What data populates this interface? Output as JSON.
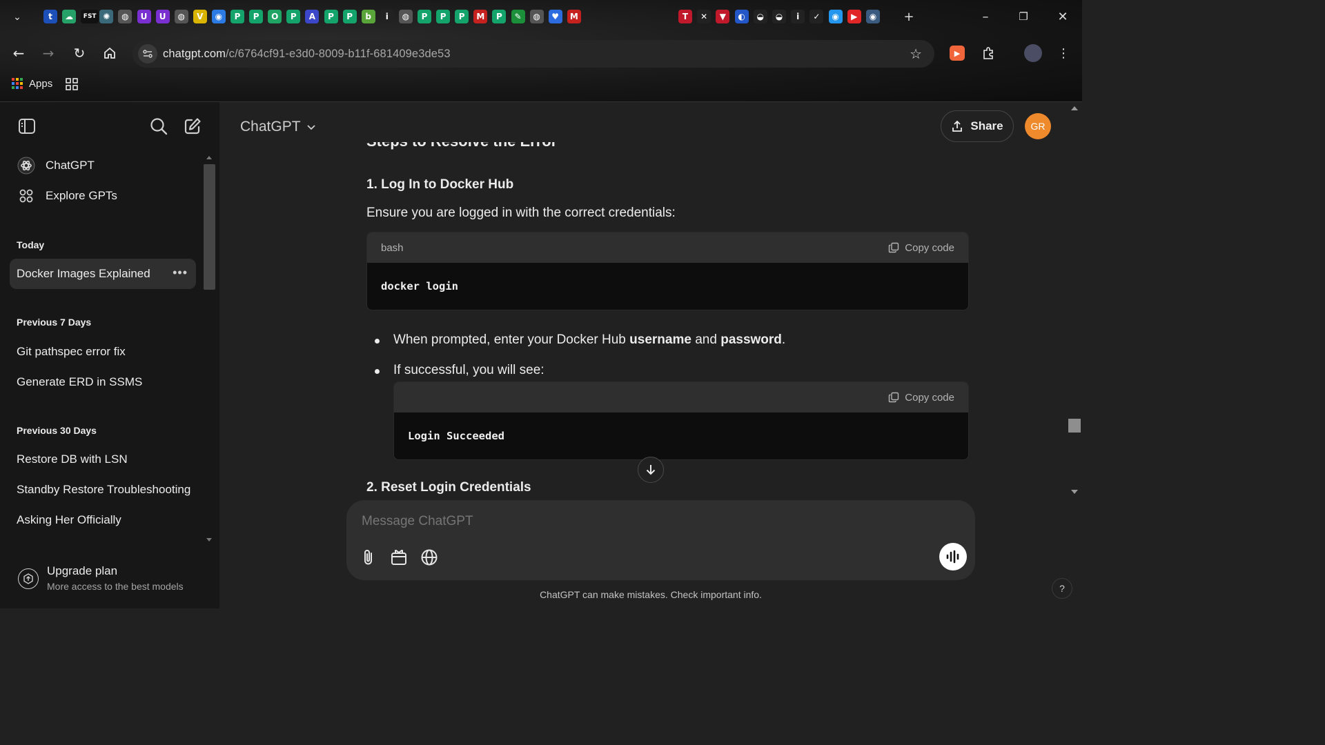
{
  "browser": {
    "url_host": "chatgpt.com",
    "url_path": "/c/6764cf91-e3d0-8009-b11f-681409e3de53",
    "bookmarks": {
      "apps_label": "Apps"
    },
    "tab_favicons": [
      {
        "name": "tumblr",
        "glyph": "t",
        "color": "#1d4fb8"
      },
      {
        "name": "cloud",
        "glyph": "☁",
        "color": "#26a269"
      },
      {
        "name": "fst",
        "glyph": "FST",
        "color": "#111111"
      },
      {
        "name": "openai",
        "glyph": "✺",
        "color": "#3a6a7a"
      },
      {
        "name": "globe",
        "glyph": "◍",
        "color": "#555555"
      },
      {
        "name": "u1",
        "glyph": "U",
        "color": "#7a2fd0"
      },
      {
        "name": "u2",
        "glyph": "U",
        "color": "#7a2fd0"
      },
      {
        "name": "globe2",
        "glyph": "◍",
        "color": "#555555"
      },
      {
        "name": "vue",
        "glyph": "V",
        "color": "#d9b400"
      },
      {
        "name": "chrome-color",
        "glyph": "◉",
        "color": "#2c7be5"
      },
      {
        "name": "p1",
        "glyph": "P",
        "color": "#14a36b"
      },
      {
        "name": "p2",
        "glyph": "P",
        "color": "#14a36b"
      },
      {
        "name": "ring",
        "glyph": "O",
        "color": "#1fa463"
      },
      {
        "name": "p3",
        "glyph": "P",
        "color": "#14a36b"
      },
      {
        "name": "a-font",
        "glyph": "A",
        "color": "#3b46c8"
      },
      {
        "name": "p4",
        "glyph": "P",
        "color": "#14a36b"
      },
      {
        "name": "p5",
        "glyph": "P",
        "color": "#14a36b"
      },
      {
        "name": "b-green",
        "glyph": "b",
        "color": "#5aa53a"
      },
      {
        "name": "info-i",
        "glyph": "i",
        "color": "#222222"
      },
      {
        "name": "globe3",
        "glyph": "◍",
        "color": "#555555"
      },
      {
        "name": "p6",
        "glyph": "P",
        "color": "#14a36b"
      },
      {
        "name": "p7",
        "glyph": "P",
        "color": "#14a36b"
      },
      {
        "name": "p8",
        "glyph": "P",
        "color": "#14a36b"
      },
      {
        "name": "gmail",
        "glyph": "M",
        "color": "#c5221f"
      },
      {
        "name": "p9",
        "glyph": "P",
        "color": "#14a36b"
      },
      {
        "name": "leaf",
        "glyph": "✎",
        "color": "#1b8f3a"
      },
      {
        "name": "globe4",
        "glyph": "◍",
        "color": "#555555"
      },
      {
        "name": "heart",
        "glyph": "♥",
        "color": "#2d6cdf"
      },
      {
        "name": "gmail2",
        "glyph": "M",
        "color": "#c5221f"
      }
    ],
    "tab_favicons_right": [
      {
        "name": "t-red",
        "glyph": "T",
        "color": "#c0192b"
      },
      {
        "name": "close-tab",
        "glyph": "✕",
        "color": "#222222"
      },
      {
        "name": "v-red",
        "glyph": "▼",
        "color": "#c0192b"
      },
      {
        "name": "blue-circle",
        "glyph": "◐",
        "color": "#2356c7"
      },
      {
        "name": "github1",
        "glyph": "◒",
        "color": "#222222"
      },
      {
        "name": "github2",
        "glyph": "◒",
        "color": "#222222"
      },
      {
        "name": "info",
        "glyph": "i",
        "color": "#222222"
      },
      {
        "name": "bird",
        "glyph": "✓",
        "color": "#222222"
      },
      {
        "name": "docker",
        "glyph": "◉",
        "color": "#2496ed"
      },
      {
        "name": "youtube",
        "glyph": "▶",
        "color": "#e02626"
      },
      {
        "name": "docker2",
        "glyph": "◉",
        "color": "#3a5a80"
      }
    ]
  },
  "sidebar": {
    "top_items": [
      {
        "label": "ChatGPT"
      },
      {
        "label": "Explore GPTs"
      }
    ],
    "sections": [
      {
        "title": "Today",
        "items": [
          {
            "label": "Docker Images Explained",
            "active": true
          }
        ]
      },
      {
        "title": "Previous 7 Days",
        "items": [
          {
            "label": "Git pathspec error fix"
          },
          {
            "label": "Generate ERD in SSMS"
          }
        ]
      },
      {
        "title": "Previous 30 Days",
        "items": [
          {
            "label": "Restore DB with LSN"
          },
          {
            "label": "Standby Restore Troubleshooting"
          },
          {
            "label": "Asking Her Officially"
          }
        ]
      }
    ],
    "more_label": "•••",
    "upgrade": {
      "title": "Upgrade plan",
      "subtitle": "More access to the best models"
    }
  },
  "header": {
    "model_label": "ChatGPT",
    "share_label": "Share",
    "avatar_initials": "GR"
  },
  "conversation": {
    "cut_heading": "Steps to Resolve the Error",
    "step1_heading": "1. Log In to Docker Hub",
    "step1_intro": "Ensure you are logged in with the correct credentials:",
    "code1": {
      "lang": "bash",
      "copy_label": "Copy code",
      "code": "docker login"
    },
    "bullet1": {
      "pre": "When prompted, enter your Docker Hub ",
      "b1": "username",
      "mid": " and ",
      "b2": "password",
      "post": "."
    },
    "bullet2": "If successful, you will see:",
    "code2": {
      "lang": "",
      "copy_label": "Copy code",
      "code": "Login Succeeded"
    },
    "step2_heading": "2. Reset Login Credentials"
  },
  "composer": {
    "placeholder": "Message ChatGPT",
    "disclaimer": "ChatGPT can make mistakes. Check important info.",
    "help_label": "?"
  },
  "colors": {
    "avatar": "#ef8a2c",
    "sidebar_bg": "#171717",
    "main_bg": "#212121",
    "code_bg": "#0d0d0d"
  }
}
